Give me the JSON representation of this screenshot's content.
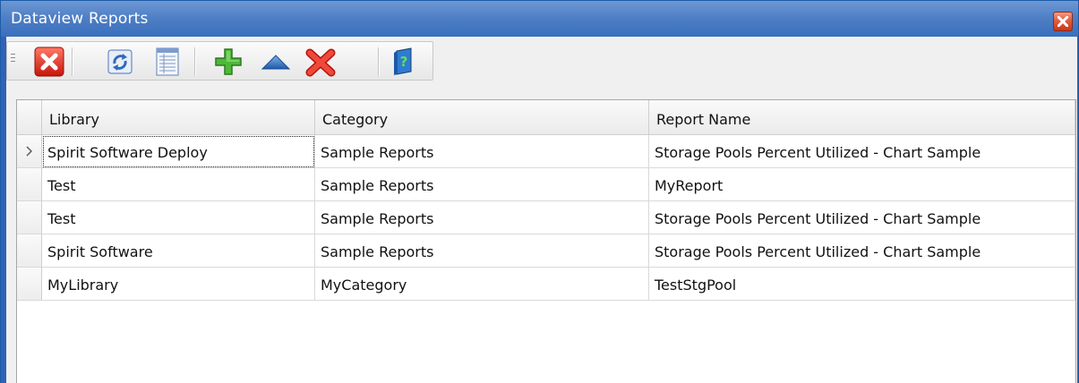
{
  "window": {
    "title": "Dataview Reports"
  },
  "toolbar": {
    "icons": [
      "close-red-icon",
      "refresh-icon",
      "report-list-icon",
      "add-icon",
      "move-up-icon",
      "delete-icon",
      "help-book-icon"
    ]
  },
  "grid": {
    "columns": [
      "Library",
      "Category",
      "Report Name"
    ],
    "rows": [
      {
        "library": "Spirit Software Deploy",
        "category": "Sample Reports",
        "report": "Storage Pools Percent Utilized - Chart Sample",
        "current": true
      },
      {
        "library": "Test",
        "category": "Sample Reports",
        "report": "MyReport"
      },
      {
        "library": "Test",
        "category": "Sample Reports",
        "report": "Storage Pools Percent Utilized - Chart Sample"
      },
      {
        "library": "Spirit Software",
        "category": "Sample Reports",
        "report": "Storage Pools Percent Utilized - Chart Sample"
      },
      {
        "library": "MyLibrary",
        "category": "MyCategory",
        "report": "TestStgPool"
      }
    ]
  },
  "colors": {
    "titlebar": "#4f80c6",
    "accent_red": "#e0402a",
    "accent_green": "#3fa72d",
    "accent_blue": "#2f6ab5"
  }
}
